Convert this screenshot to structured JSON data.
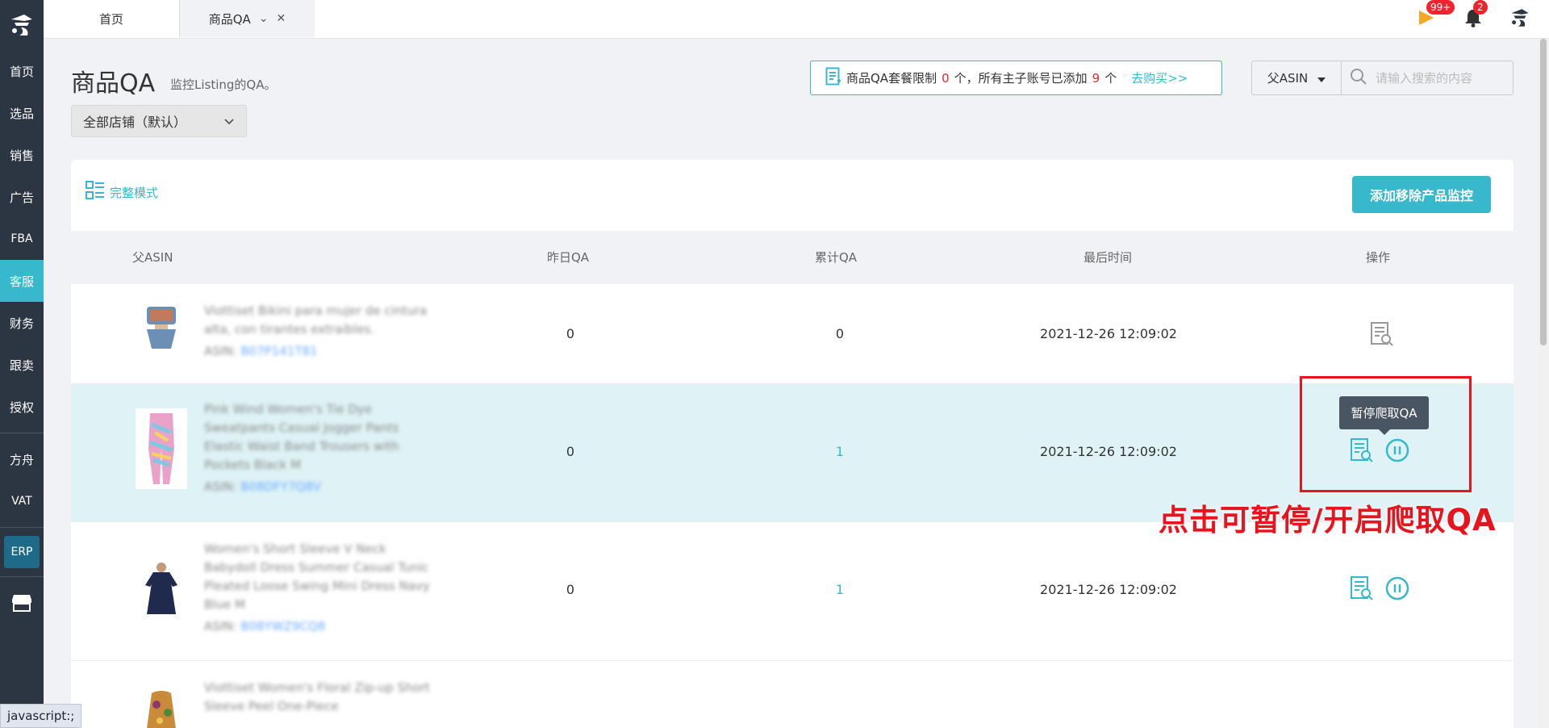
{
  "sidebar": {
    "items": [
      {
        "label": "首页"
      },
      {
        "label": "选品"
      },
      {
        "label": "销售"
      },
      {
        "label": "广告"
      },
      {
        "label": "FBA"
      },
      {
        "label": "客服"
      },
      {
        "label": "财务"
      },
      {
        "label": "跟卖"
      },
      {
        "label": "授权"
      },
      {
        "label": "方舟"
      },
      {
        "label": "VAT"
      }
    ],
    "active": "客服",
    "erp_label": "ERP"
  },
  "tabs": {
    "home": "首页",
    "qa": "商品QA"
  },
  "topbar": {
    "flag_badge": "99+",
    "bell_badge": "2"
  },
  "header": {
    "title": "商品QA",
    "subtitle": "监控Listing的QA。",
    "store_select": "全部店铺（默认）"
  },
  "quota": {
    "text1": "商品QA套餐限制",
    "limit": "0",
    "text2": "个，所有主子账号已添加",
    "added": "9",
    "text3": "个",
    "link": "去购买>>"
  },
  "search": {
    "type": "父ASIN",
    "placeholder": "请输入搜索的内容"
  },
  "toolbar": {
    "mode_label": "完整模式",
    "add_button": "添加移除产品监控"
  },
  "table": {
    "headers": [
      "父ASIN",
      "昨日QA",
      "累计QA",
      "最后时间",
      "操作"
    ],
    "rows": [
      {
        "title": "Viottiset Bikini para mujer de cintura alta, con tirantes extraibles.",
        "asin_label": "ASIN:",
        "asin": "B07P141T81",
        "yesterday": "0",
        "total": "0",
        "time": "2021-12-26 12:09:02"
      },
      {
        "title": "Pink Wind Women's Tie Dye Sweatpants Casual Jogger Pants Elastic Waist Band Trousers with Pockets Black M",
        "asin_label": "ASIN:",
        "asin": "B08DFY7Q8V",
        "yesterday": "0",
        "total": "1",
        "time": "2021-12-26 12:09:02"
      },
      {
        "title": "Women's Short Sleeve V Neck Babydoll Dress Summer Casual Tunic Pleated Loose Swing Mini Dress Navy Blue M",
        "asin_label": "ASIN:",
        "asin": "B08YWZ9CQ8",
        "yesterday": "0",
        "total": "1",
        "time": "2021-12-26 12:09:02"
      },
      {
        "title": "Viottiset Women's Floral Zip-up Short Sleeve Peel One-Piece"
      }
    ]
  },
  "tooltip": "暂停爬取QA",
  "annotation": "点击可暂停/开启爬取QA",
  "statusbar": "javascript:;",
  "colors": {
    "accent": "#38b8cc",
    "sidebar": "#2c3542",
    "red": "#e8131c"
  }
}
